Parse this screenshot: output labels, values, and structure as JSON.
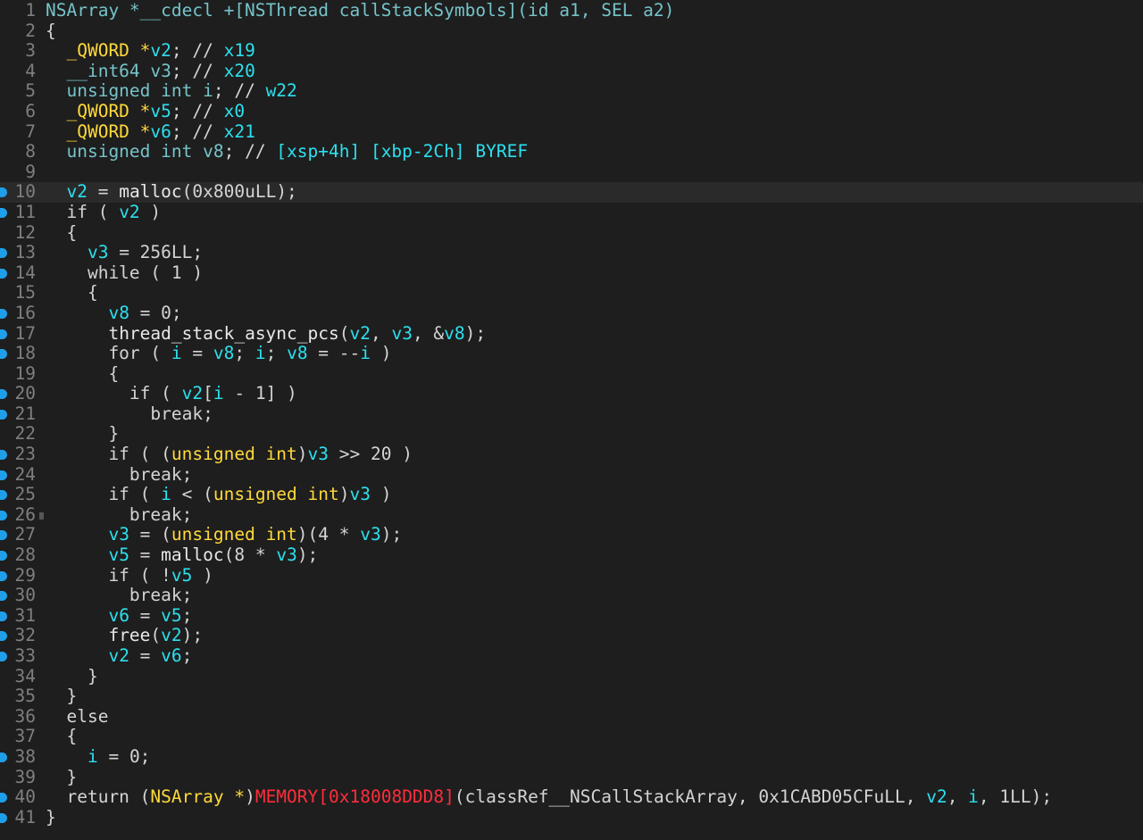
{
  "editor": {
    "current_line": 10,
    "lines": [
      {
        "n": "1",
        "bp": false,
        "tokens": [
          [
            "teal",
            "NSArray *__cdecl +[NSThread callStackSymbols](id a1, SEL a2)"
          ]
        ]
      },
      {
        "n": "2",
        "bp": false,
        "tokens": [
          [
            "plain",
            "{"
          ]
        ]
      },
      {
        "n": "3",
        "bp": false,
        "tokens": [
          [
            "plain",
            "  "
          ],
          [
            "type",
            "_QWORD *"
          ],
          [
            "var",
            "v2"
          ],
          [
            "plain",
            "; // "
          ],
          [
            "var",
            "x19"
          ]
        ]
      },
      {
        "n": "4",
        "bp": false,
        "tokens": [
          [
            "plain",
            "  "
          ],
          [
            "teal",
            "__int64 v3"
          ],
          [
            "plain",
            "; // "
          ],
          [
            "var",
            "x20"
          ]
        ]
      },
      {
        "n": "5",
        "bp": false,
        "tokens": [
          [
            "plain",
            "  "
          ],
          [
            "teal",
            "unsigned int i"
          ],
          [
            "plain",
            "; // "
          ],
          [
            "var",
            "w22"
          ]
        ]
      },
      {
        "n": "6",
        "bp": false,
        "tokens": [
          [
            "plain",
            "  "
          ],
          [
            "type",
            "_QWORD *"
          ],
          [
            "var",
            "v5"
          ],
          [
            "plain",
            "; // "
          ],
          [
            "var",
            "x0"
          ]
        ]
      },
      {
        "n": "7",
        "bp": false,
        "tokens": [
          [
            "plain",
            "  "
          ],
          [
            "type",
            "_QWORD *"
          ],
          [
            "var",
            "v6"
          ],
          [
            "plain",
            "; // "
          ],
          [
            "var",
            "x21"
          ]
        ]
      },
      {
        "n": "8",
        "bp": false,
        "tokens": [
          [
            "plain",
            "  "
          ],
          [
            "teal",
            "unsigned int v8"
          ],
          [
            "plain",
            "; // "
          ],
          [
            "var",
            "[xsp+4h] [xbp-2Ch] BYREF"
          ]
        ]
      },
      {
        "n": "9",
        "bp": false,
        "tokens": []
      },
      {
        "n": "10",
        "bp": true,
        "tokens": [
          [
            "plain",
            "  "
          ],
          [
            "var",
            "v2"
          ],
          [
            "plain",
            " = "
          ],
          [
            "func",
            "malloc"
          ],
          [
            "plain",
            "(0x800uLL);"
          ]
        ]
      },
      {
        "n": "11",
        "bp": true,
        "tokens": [
          [
            "plain",
            "  if ( "
          ],
          [
            "var",
            "v2"
          ],
          [
            "plain",
            " )"
          ]
        ]
      },
      {
        "n": "12",
        "bp": false,
        "tokens": [
          [
            "plain",
            "  {"
          ]
        ]
      },
      {
        "n": "13",
        "bp": true,
        "tokens": [
          [
            "plain",
            "    "
          ],
          [
            "var",
            "v3"
          ],
          [
            "plain",
            " = 256LL;"
          ]
        ]
      },
      {
        "n": "14",
        "bp": true,
        "tokens": [
          [
            "plain",
            "    while ( 1 )"
          ]
        ]
      },
      {
        "n": "15",
        "bp": false,
        "tokens": [
          [
            "plain",
            "    {"
          ]
        ]
      },
      {
        "n": "16",
        "bp": true,
        "tokens": [
          [
            "plain",
            "      "
          ],
          [
            "var",
            "v8"
          ],
          [
            "plain",
            " = 0;"
          ]
        ]
      },
      {
        "n": "17",
        "bp": true,
        "tokens": [
          [
            "plain",
            "      "
          ],
          [
            "func",
            "thread_stack_async_pcs"
          ],
          [
            "plain",
            "("
          ],
          [
            "var",
            "v2"
          ],
          [
            "plain",
            ", "
          ],
          [
            "var",
            "v3"
          ],
          [
            "plain",
            ", &"
          ],
          [
            "var",
            "v8"
          ],
          [
            "plain",
            ");"
          ]
        ]
      },
      {
        "n": "18",
        "bp": true,
        "tokens": [
          [
            "plain",
            "      for ( "
          ],
          [
            "var",
            "i"
          ],
          [
            "plain",
            " = "
          ],
          [
            "var",
            "v8"
          ],
          [
            "plain",
            "; "
          ],
          [
            "var",
            "i"
          ],
          [
            "plain",
            "; "
          ],
          [
            "var",
            "v8"
          ],
          [
            "plain",
            " = --"
          ],
          [
            "var",
            "i"
          ],
          [
            "plain",
            " )"
          ]
        ]
      },
      {
        "n": "19",
        "bp": false,
        "tokens": [
          [
            "plain",
            "      {"
          ]
        ]
      },
      {
        "n": "20",
        "bp": true,
        "tokens": [
          [
            "plain",
            "        if ( "
          ],
          [
            "var",
            "v2"
          ],
          [
            "plain",
            "["
          ],
          [
            "var",
            "i"
          ],
          [
            "plain",
            " - 1] )"
          ]
        ]
      },
      {
        "n": "21",
        "bp": true,
        "tokens": [
          [
            "plain",
            "          break;"
          ]
        ]
      },
      {
        "n": "22",
        "bp": false,
        "tokens": [
          [
            "plain",
            "      }"
          ]
        ]
      },
      {
        "n": "23",
        "bp": true,
        "tokens": [
          [
            "plain",
            "      if ( ("
          ],
          [
            "type",
            "unsigned int"
          ],
          [
            "plain",
            ")"
          ],
          [
            "var",
            "v3"
          ],
          [
            "plain",
            " >> 20 )"
          ]
        ]
      },
      {
        "n": "24",
        "bp": true,
        "tokens": [
          [
            "plain",
            "        break;"
          ]
        ]
      },
      {
        "n": "25",
        "bp": true,
        "tokens": [
          [
            "plain",
            "      if ( "
          ],
          [
            "var",
            "i"
          ],
          [
            "plain",
            " < ("
          ],
          [
            "type",
            "unsigned int"
          ],
          [
            "plain",
            ")"
          ],
          [
            "var",
            "v3"
          ],
          [
            "plain",
            " )"
          ]
        ]
      },
      {
        "n": "26",
        "bp": true,
        "mark": true,
        "tokens": [
          [
            "plain",
            "        break;"
          ]
        ]
      },
      {
        "n": "27",
        "bp": true,
        "tokens": [
          [
            "plain",
            "      "
          ],
          [
            "var",
            "v3"
          ],
          [
            "plain",
            " = ("
          ],
          [
            "type",
            "unsigned int"
          ],
          [
            "plain",
            ")(4 * "
          ],
          [
            "var",
            "v3"
          ],
          [
            "plain",
            ");"
          ]
        ]
      },
      {
        "n": "28",
        "bp": true,
        "tokens": [
          [
            "plain",
            "      "
          ],
          [
            "var",
            "v5"
          ],
          [
            "plain",
            " = "
          ],
          [
            "func",
            "malloc"
          ],
          [
            "plain",
            "(8 * "
          ],
          [
            "var",
            "v3"
          ],
          [
            "plain",
            ");"
          ]
        ]
      },
      {
        "n": "29",
        "bp": true,
        "tokens": [
          [
            "plain",
            "      if ( !"
          ],
          [
            "var",
            "v5"
          ],
          [
            "plain",
            " )"
          ]
        ]
      },
      {
        "n": "30",
        "bp": true,
        "tokens": [
          [
            "plain",
            "        break;"
          ]
        ]
      },
      {
        "n": "31",
        "bp": true,
        "tokens": [
          [
            "plain",
            "      "
          ],
          [
            "var",
            "v6"
          ],
          [
            "plain",
            " = "
          ],
          [
            "var",
            "v5"
          ],
          [
            "plain",
            ";"
          ]
        ]
      },
      {
        "n": "32",
        "bp": true,
        "tokens": [
          [
            "plain",
            "      "
          ],
          [
            "func",
            "free"
          ],
          [
            "plain",
            "("
          ],
          [
            "var",
            "v2"
          ],
          [
            "plain",
            ");"
          ]
        ]
      },
      {
        "n": "33",
        "bp": true,
        "tokens": [
          [
            "plain",
            "      "
          ],
          [
            "var",
            "v2"
          ],
          [
            "plain",
            " = "
          ],
          [
            "var",
            "v6"
          ],
          [
            "plain",
            ";"
          ]
        ]
      },
      {
        "n": "34",
        "bp": false,
        "tokens": [
          [
            "plain",
            "    }"
          ]
        ]
      },
      {
        "n": "35",
        "bp": false,
        "tokens": [
          [
            "plain",
            "  }"
          ]
        ]
      },
      {
        "n": "36",
        "bp": false,
        "tokens": [
          [
            "plain",
            "  else"
          ]
        ]
      },
      {
        "n": "37",
        "bp": false,
        "tokens": [
          [
            "plain",
            "  {"
          ]
        ]
      },
      {
        "n": "38",
        "bp": true,
        "tokens": [
          [
            "plain",
            "    "
          ],
          [
            "var",
            "i"
          ],
          [
            "plain",
            " = 0;"
          ]
        ]
      },
      {
        "n": "39",
        "bp": false,
        "tokens": [
          [
            "plain",
            "  }"
          ]
        ]
      },
      {
        "n": "40",
        "bp": true,
        "tokens": [
          [
            "plain",
            "  return ("
          ],
          [
            "type",
            "NSArray *"
          ],
          [
            "plain",
            ")"
          ],
          [
            "mem",
            "MEMORY[0x18008DDD8]"
          ],
          [
            "plain",
            "(classRef__NSCallStackArray, 0x1CABD05CFuLL, "
          ],
          [
            "var",
            "v2"
          ],
          [
            "plain",
            ", "
          ],
          [
            "var",
            "i"
          ],
          [
            "plain",
            ", 1LL);"
          ]
        ]
      },
      {
        "n": "41",
        "bp": true,
        "tokens": [
          [
            "plain",
            "}"
          ]
        ]
      }
    ]
  }
}
